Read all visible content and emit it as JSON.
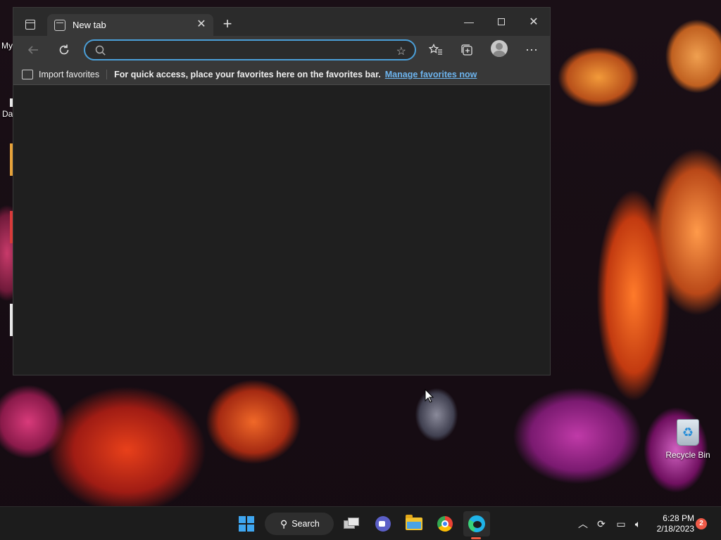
{
  "desktop": {
    "left_labels": [
      "My",
      "Da"
    ],
    "recycle_bin_label": "Recycle Bin"
  },
  "browser": {
    "tab": {
      "title": "New tab"
    },
    "address": {
      "value": "",
      "placeholder": ""
    },
    "favorites_bar": {
      "import_label": "Import favorites",
      "message": "For quick access, place your favorites here on the favorites bar.",
      "manage_link": "Manage favorites now"
    }
  },
  "taskbar": {
    "search_label": "Search",
    "clock_time": "6:28 PM",
    "clock_date": "2/18/2023",
    "notification_count": "2",
    "pinned_apps": [
      "task-view-icon",
      "teams-icon",
      "file-explorer-icon",
      "chrome-icon",
      "edge-icon"
    ]
  },
  "colors": {
    "accent": "#4b9fd8",
    "link": "#6db4ee",
    "notification": "#ef5a48"
  }
}
